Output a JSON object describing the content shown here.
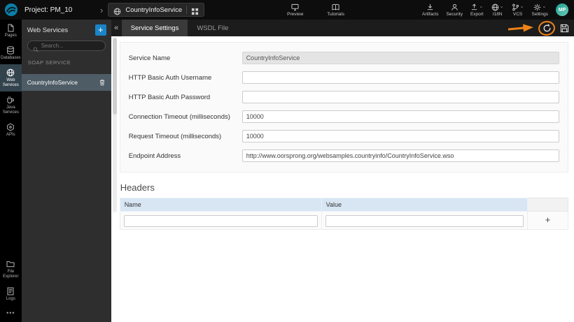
{
  "topbar": {
    "project_label": "Project: PM_10",
    "service_name": "CountryInfoService",
    "preview_label": "Preview",
    "tutorials_label": "Tutorials",
    "menu": [
      {
        "label": "Artifacts",
        "chevron": false
      },
      {
        "label": "Security",
        "chevron": false
      },
      {
        "label": "Export",
        "chevron": true
      },
      {
        "label": "I18N",
        "chevron": true
      },
      {
        "label": "VCS",
        "chevron": true
      },
      {
        "label": "Settings",
        "chevron": true
      }
    ],
    "avatar_initials": "MP"
  },
  "sidebar": {
    "items": [
      {
        "label": "Pages"
      },
      {
        "label": "Databases"
      },
      {
        "label": "Web Services"
      },
      {
        "label": "Java Services"
      },
      {
        "label": "APIs"
      }
    ],
    "bottom_items": [
      {
        "label": "File Explorer"
      },
      {
        "label": "Logs"
      }
    ],
    "more_label": "•••"
  },
  "panel": {
    "title": "Web Services",
    "add_button": "+",
    "collapse_button": "«",
    "search_placeholder": "Search...",
    "section_label": "SOAP SERVICE",
    "service_item": "CountryInfoService"
  },
  "tabs": {
    "items": [
      {
        "label": "Service Settings"
      },
      {
        "label": "WSDL File"
      }
    ]
  },
  "form": {
    "fields": [
      {
        "label": "Service Name",
        "value": "CountryInfoService"
      },
      {
        "label": "HTTP Basic Auth Username",
        "value": ""
      },
      {
        "label": "HTTP Basic Auth Password",
        "value": ""
      },
      {
        "label": "Connection Timeout (milliseconds)",
        "value": "10000"
      },
      {
        "label": "Request Timeout (milliseconds)",
        "value": "10000"
      },
      {
        "label": "Endpoint Address",
        "value": "http://www.oorsprong.org/websamples.countryinfo/CountryInfoService.wso"
      }
    ]
  },
  "headers_table": {
    "title": "Headers",
    "columns": [
      "Name",
      "Value"
    ],
    "add_button": "+"
  },
  "colors": {
    "accent_blue": "#1a84c7",
    "annotation_orange": "#ef8318",
    "table_header_bg": "#d8e6f4"
  }
}
